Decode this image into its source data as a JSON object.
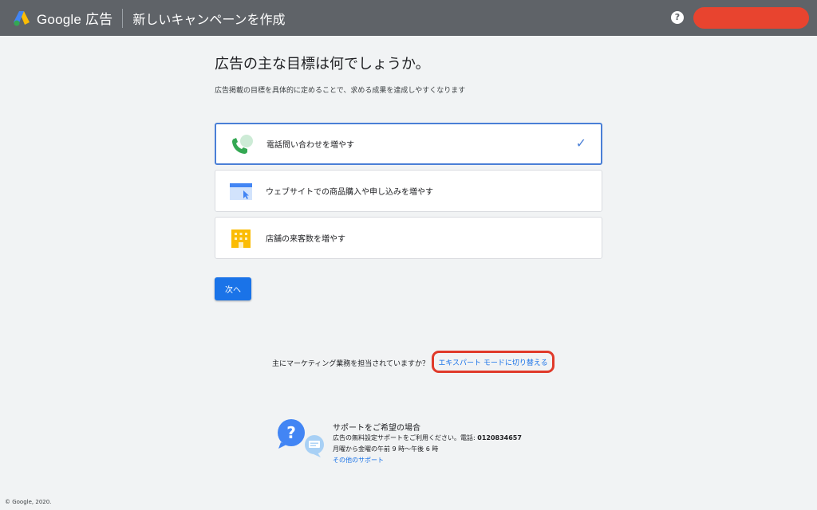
{
  "header": {
    "brand": "Google 広告",
    "title": "新しいキャンペーンを作成",
    "help_icon": "?",
    "account_color": "#e8442f"
  },
  "main": {
    "heading": "広告の主な目標は何でしょうか。",
    "subtext": "広告掲載の目標を具体的に定めることで、求める成果を達成しやすくなります",
    "options": [
      {
        "label": "電話問い合わせを増やす",
        "icon": "phone-call-icon",
        "selected": true
      },
      {
        "label": "ウェブサイトでの商品購入や申し込みを増やす",
        "icon": "website-cursor-icon",
        "selected": false
      },
      {
        "label": "店舗の来客数を増やす",
        "icon": "store-building-icon",
        "selected": false
      }
    ],
    "check_icon": "✓",
    "next_label": "次へ"
  },
  "expert": {
    "question": "主にマーケティング業務を担当されていますか？",
    "link": "エキスパート モードに切り替える"
  },
  "support": {
    "title": "サポートをご希望の場合",
    "line1_prefix": "広告の無料設定サポートをご利用ください。電話: ",
    "phone": "0120834657",
    "hours": "月曜から金曜の午前 9 時〜午後 6 時",
    "other_link": "その他のサポート"
  },
  "footer": {
    "copyright": "© Google, 2020."
  },
  "colors": {
    "accent": "#1a73e8",
    "selected_border": "#4a7fd6",
    "highlight_red": "#e03a2a",
    "header_bg": "#5f6368"
  }
}
